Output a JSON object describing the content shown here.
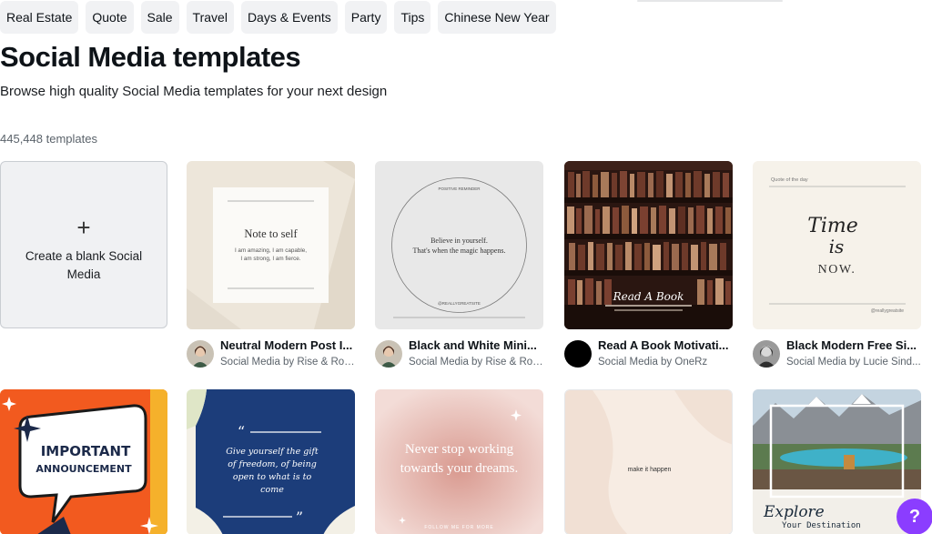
{
  "filter_chips": [
    "Real Estate",
    "Quote",
    "Sale",
    "Travel",
    "Days & Events",
    "Party",
    "Tips",
    "Chinese New Year"
  ],
  "page": {
    "title": "Social Media templates",
    "subtitle": "Browse high quality Social Media templates for your next design",
    "count": "445,448 templates"
  },
  "blank_card": {
    "icon": "plus-icon",
    "label": "Create a blank Social Media"
  },
  "templates": [
    {
      "title": "Neutral Modern Post I...",
      "byline": "Social Media by Rise & Roa...",
      "thumb_text": {
        "heading": "Note to self",
        "body1": "I am amazing, I am capable,",
        "body2": "I am strong, I am fierce."
      }
    },
    {
      "title": "Black and White Mini...",
      "byline": "Social Media by Rise & Roa...",
      "thumb_text": {
        "line1": "Believe in yourself.",
        "line2": "That's when the magic happens.",
        "arc_top": "POSITIVE REMINDER",
        "arc_bottom": "@REALLYGREATSITE"
      }
    },
    {
      "title": "Read A Book Motivati...",
      "byline": "Social Media by OneRz",
      "thumb_text": {
        "script": "Read A Book"
      }
    },
    {
      "title": "Black Modern Free Si...",
      "byline": "Social Media by Lucie Sind...",
      "thumb_text": {
        "label": "Quote of the day",
        "line1": "Time",
        "line2": "is",
        "line3": "NOW.",
        "handle": "@reallygreatsite"
      }
    }
  ],
  "row2_thumbs": [
    {
      "line1": "IMPORTANT",
      "line2": "ANNOUNCEMENT"
    },
    {
      "quote": "Give yourself the gift of freedom, of being open to what is to come"
    },
    {
      "quote": "Never stop working towards your dreams.",
      "footer": "FOLLOW ME FOR MORE"
    },
    {
      "text": "make it happen"
    },
    {
      "script": "Explore",
      "sub": "Your Destination"
    }
  ],
  "help_button": {
    "label": "?"
  },
  "colors": {
    "accent": "#8b3dff",
    "chip_bg": "#f1f2f4",
    "navy": "#1c3d7a",
    "orange": "#f25a1f"
  }
}
